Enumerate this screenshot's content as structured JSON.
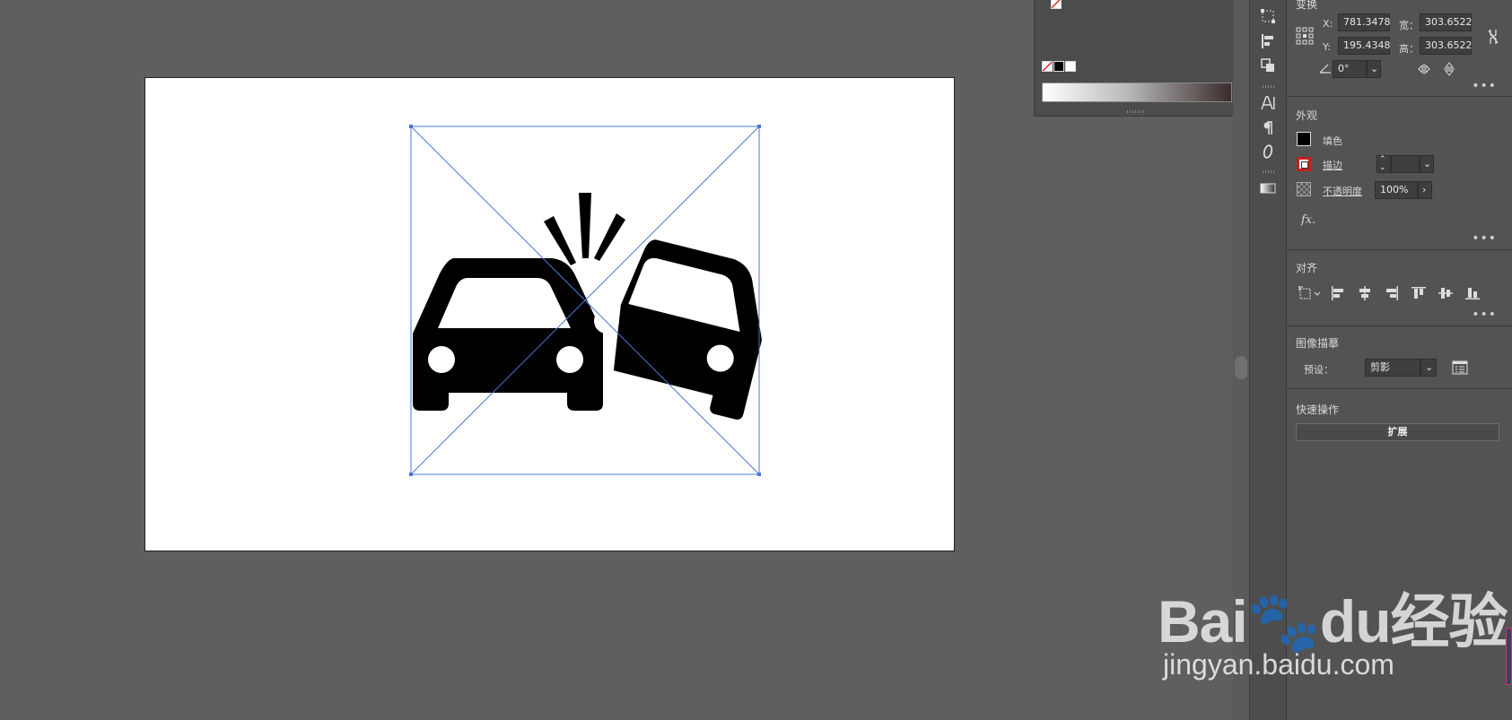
{
  "transform": {
    "title": "变换",
    "x_label": "X:",
    "x_value": "781.3478",
    "y_label": "Y:",
    "y_value": "195.4348",
    "w_label": "宽：",
    "w_value": "303.6522",
    "h_label": "高：",
    "h_value": "303.6522",
    "angle_value": "0°"
  },
  "appearance": {
    "title": "外观",
    "fill_label": "填色",
    "stroke_label": "描边",
    "opacity_label": "不透明度",
    "opacity_value": "100%",
    "fx_label": "fx."
  },
  "align": {
    "title": "对齐"
  },
  "image_trace": {
    "title": "图像描摹",
    "preset_label": "预设：",
    "preset_value": "剪影"
  },
  "quick_actions": {
    "title": "快速操作",
    "expand_label": "扩展"
  },
  "more_label": "•••",
  "watermark": {
    "logo_text": "Bai🐾du经验",
    "url": "jingyan.baidu.com"
  },
  "colors": {
    "selection": "#4a78d4",
    "annotation_arrow": "#e03a30",
    "panel_bg": "#535353",
    "canvas_bg": "#5f5f5f"
  }
}
